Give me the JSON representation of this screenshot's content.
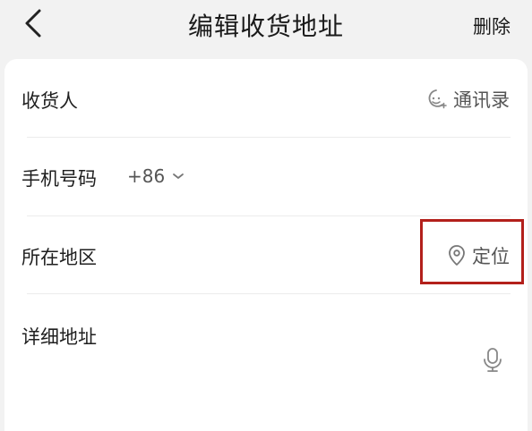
{
  "header": {
    "title": "编辑收货地址",
    "delete_label": "删除"
  },
  "form": {
    "recipient": {
      "label": "收货人",
      "contacts_label": "通讯录"
    },
    "phone": {
      "label": "手机号码",
      "country_code": "+86"
    },
    "region": {
      "label": "所在地区",
      "locate_label": "定位"
    },
    "address": {
      "label": "详细地址"
    }
  },
  "icons": {
    "back": "chevron-left-icon",
    "contacts": "contacts-icon",
    "dropdown": "chevron-down-icon",
    "location": "location-pin-icon",
    "microphone": "microphone-icon"
  },
  "colors": {
    "background": "#f2f2f2",
    "card": "#ffffff",
    "highlight": "#b3201b",
    "secondary_text": "#555555"
  }
}
